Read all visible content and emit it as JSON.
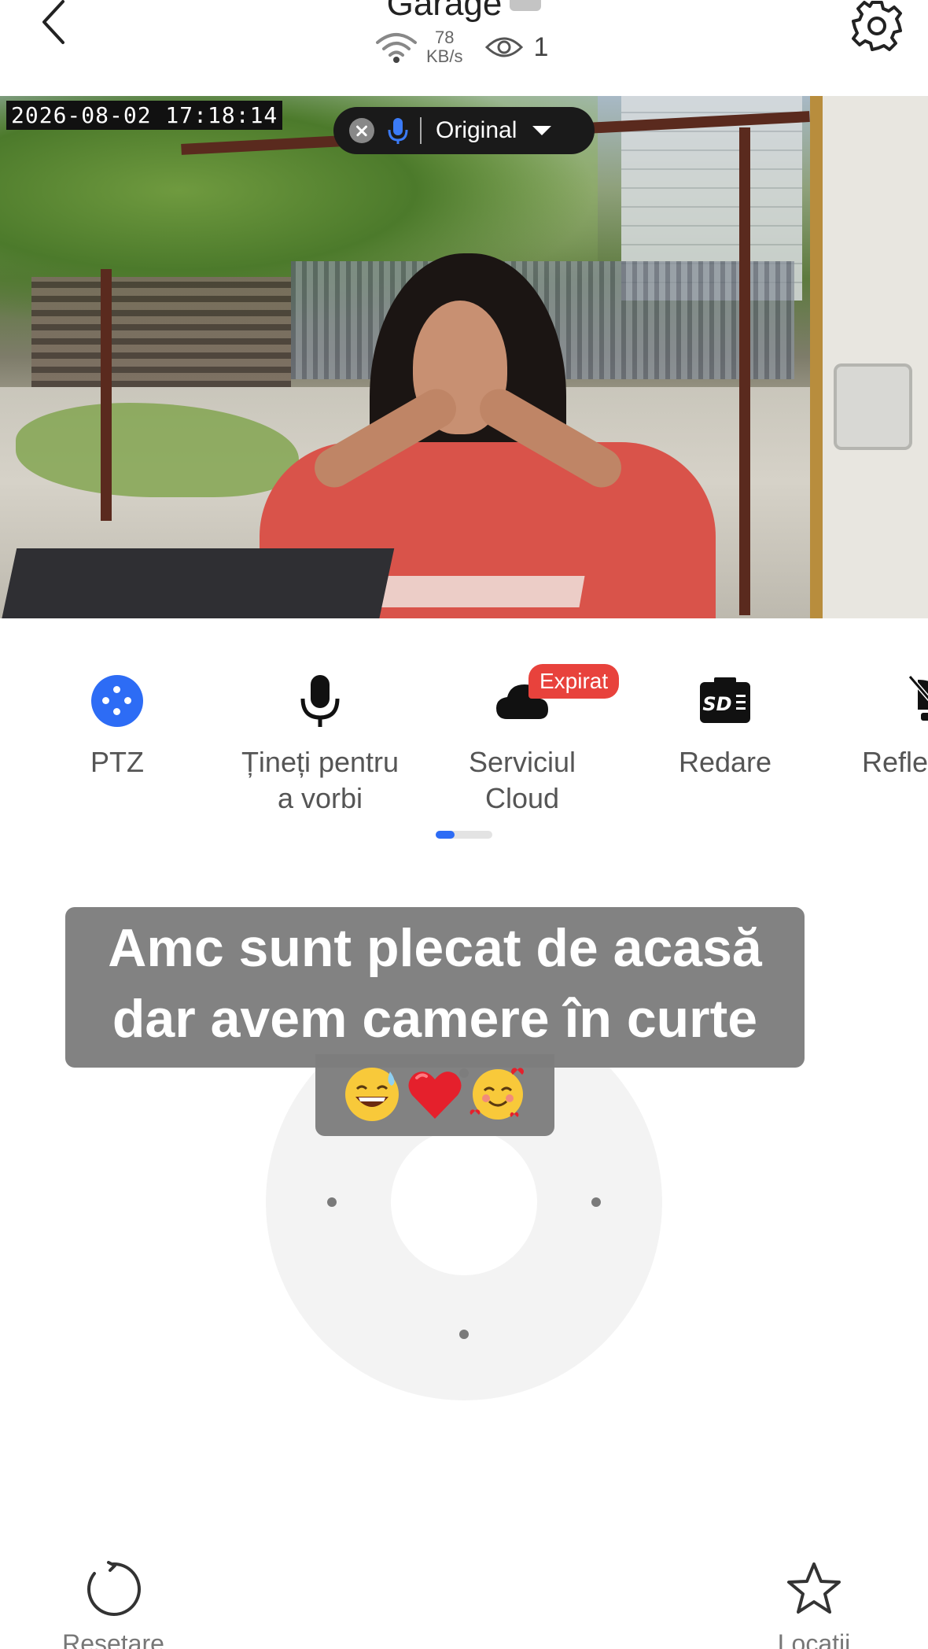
{
  "header": {
    "back_icon": "chevron-left-icon",
    "title": "Garage",
    "wifi_icon": "wifi-icon",
    "rate_value": "78",
    "rate_unit": "KB/s",
    "viewers_icon": "eye-icon",
    "viewers_count": "1",
    "settings_icon": "gear-icon"
  },
  "video": {
    "timestamp": "2026-08-02 17:18:14",
    "talk_bar": {
      "close_icon": "close-icon",
      "mic_icon": "microphone-icon",
      "quality": "Original",
      "caret_icon": "caret-down-icon"
    }
  },
  "toolbar": {
    "items": [
      {
        "label": "PTZ",
        "icon": "ptz-icon",
        "accent": "#2d6cf5"
      },
      {
        "label_line1": "Țineți pentru",
        "label_line2": "a vorbi",
        "icon": "microphone-icon"
      },
      {
        "label_line1": "Serviciul",
        "label_line2": "Cloud",
        "icon": "cloud-icon",
        "badge": "Expirat",
        "badge_color": "#e8423c"
      },
      {
        "label": "Redare",
        "icon": "sd-card-icon"
      },
      {
        "label": "Refle",
        "icon": "light-icon"
      }
    ],
    "page_indicator": {
      "pages": 3,
      "active": 0
    }
  },
  "caption": {
    "line1": "Amc sunt plecat de acasă",
    "line2": "dar avem camere în curte",
    "emojis": [
      "sweat-smile-emoji",
      "red-heart-emoji",
      "smiling-face-with-hearts-emoji"
    ]
  },
  "joystick": {
    "icon": "ptz-joystick"
  },
  "bottom": {
    "reset_label": "Resetare",
    "reset_icon": "refresh-icon",
    "locations_label": "Locații",
    "locations_icon": "star-icon"
  }
}
